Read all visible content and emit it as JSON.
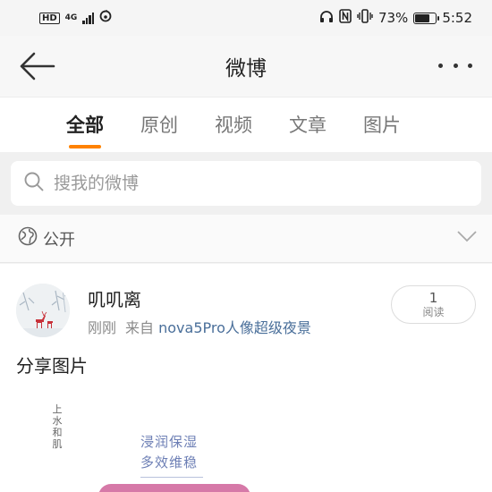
{
  "status_bar": {
    "hd": "HD",
    "network_gen": "4G",
    "network_sub": "1.11",
    "battery_percent": "73%",
    "battery_level": 0.73,
    "time": "5:52"
  },
  "header": {
    "title": "微博"
  },
  "tabs": [
    {
      "label": "全部",
      "active": true
    },
    {
      "label": "原创",
      "active": false
    },
    {
      "label": "视频",
      "active": false
    },
    {
      "label": "文章",
      "active": false
    },
    {
      "label": "图片",
      "active": false
    }
  ],
  "search": {
    "placeholder": "搜我的微博"
  },
  "visibility": {
    "label": "公开"
  },
  "post": {
    "username": "叽叽离",
    "time": "刚刚",
    "source_prefix": "来自",
    "source_device": "nova5Pro人像超级夜景",
    "read_count": "1",
    "read_label": "阅读",
    "text": "分享图片",
    "image": {
      "brand_mark": [
        "上",
        "水",
        "和",
        "肌"
      ],
      "tagline": [
        "浸润保湿",
        "多效维稳"
      ]
    }
  },
  "colors": {
    "accent": "#ff8200",
    "link": "#4a6f9a",
    "tagline": "#6d7fb5"
  }
}
